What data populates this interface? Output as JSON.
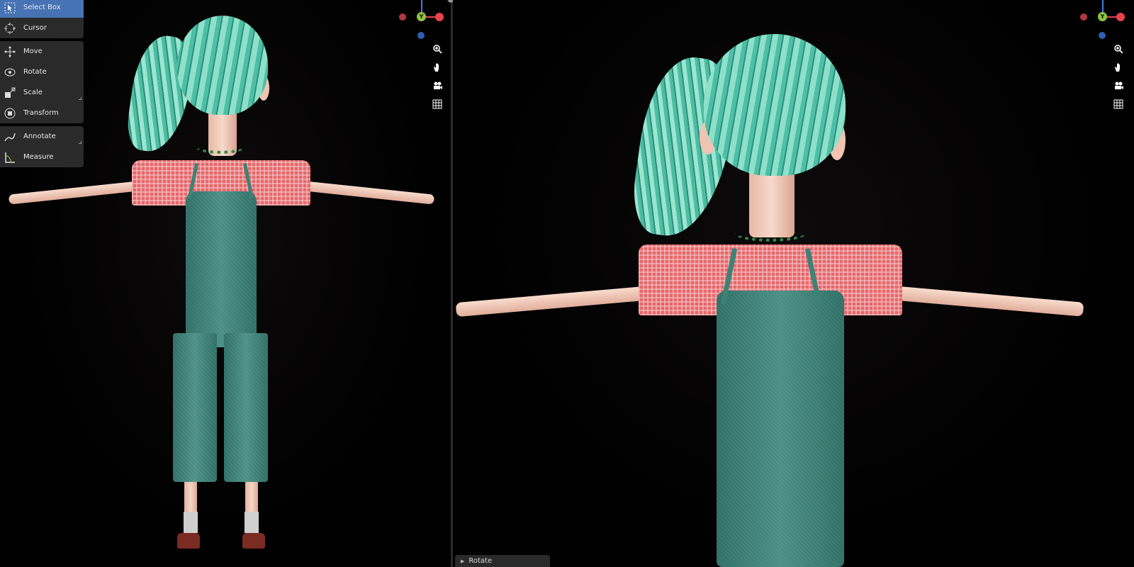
{
  "toolbar": {
    "groups": [
      [
        {
          "label": "Select Box",
          "icon": "select-box-icon",
          "active": true
        },
        {
          "label": "Cursor",
          "icon": "cursor-icon"
        }
      ],
      [
        {
          "label": "Move",
          "icon": "move-icon"
        },
        {
          "label": "Rotate",
          "icon": "rotate-icon"
        },
        {
          "label": "Scale",
          "icon": "scale-icon"
        },
        {
          "label": "Transform",
          "icon": "transform-icon"
        }
      ],
      [
        {
          "label": "Annotate",
          "icon": "annotate-icon"
        },
        {
          "label": "Measure",
          "icon": "measure-icon"
        }
      ]
    ]
  },
  "gizmo": {
    "y_label": "Y",
    "colors": {
      "x": "#e8434f",
      "y": "#8cc63e",
      "z": "#3b7fe0",
      "neg_x": "#b3373f",
      "neg_z": "#2f5fb0"
    }
  },
  "navigation": [
    "zoom-icon",
    "pan-hand-icon",
    "camera-icon",
    "ortho-grid-icon"
  ],
  "status": {
    "operator_panel": "Rotate"
  },
  "colors": {
    "hair": "#5ccfb3",
    "shirt": "#e3696d",
    "overalls": "#3f8478",
    "skin": "#f2cbb9",
    "toolbar_bg": "#2a2a2a",
    "active_tool": "#4772b3"
  }
}
